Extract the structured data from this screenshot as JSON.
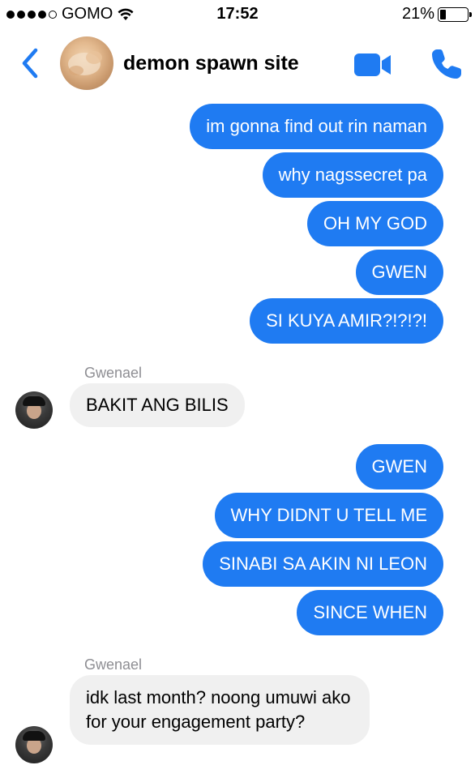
{
  "status_bar": {
    "carrier": "GOMO",
    "time": "17:52",
    "battery": "21%",
    "battery_level": 0.21
  },
  "header": {
    "title": "demon spawn site",
    "icons": {
      "back": "chevron-left-icon",
      "video": "video-camera-icon",
      "call": "phone-icon"
    },
    "accent_color": "#1f7bf2"
  },
  "messages": [
    {
      "side": "out",
      "text": "im gonna find out rin naman"
    },
    {
      "side": "out",
      "text": "why nagssecret pa"
    },
    {
      "side": "out",
      "text": "OH MY GOD"
    },
    {
      "side": "out",
      "text": "GWEN"
    },
    {
      "side": "out",
      "text": "SI KUYA AMIR?!?!?!"
    },
    {
      "side": "in",
      "sender": "Gwenael",
      "text": "BAKIT ANG BILIS"
    },
    {
      "side": "out",
      "text": "GWEN"
    },
    {
      "side": "out",
      "text": "WHY DIDNT U TELL ME"
    },
    {
      "side": "out",
      "text": "SINABI SA AKIN NI LEON"
    },
    {
      "side": "out",
      "text": "SINCE WHEN"
    },
    {
      "side": "in",
      "sender": "Gwenael",
      "text": "idk last month? noong umuwi ako for your engagement party?"
    }
  ]
}
